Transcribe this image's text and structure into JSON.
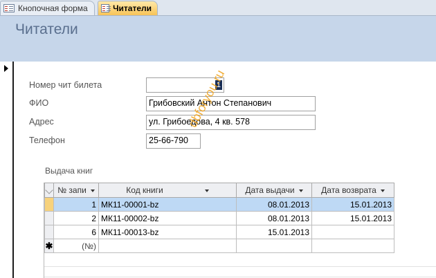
{
  "tabs": [
    {
      "label": "Кнопочная форма",
      "icon": "form-icon"
    },
    {
      "label": "Читатели",
      "icon": "form-icon"
    }
  ],
  "form": {
    "title": "Читатели",
    "fields": {
      "ticket": {
        "label": "Номер чит билета",
        "value": "1"
      },
      "fio": {
        "label": "ФИО",
        "value": "Грибовский Антон Степанович"
      },
      "address": {
        "label": "Адрес",
        "value": "ул. Грибоедова, 4 кв. 578"
      },
      "phone": {
        "label": "Телефон",
        "value": "25-66-790"
      }
    },
    "watermark": "dbforyou.ru"
  },
  "subform": {
    "label": "Выдача книг",
    "columns": [
      "№ запи",
      "Код книги",
      "Дата выдачи",
      "Дата возврата"
    ],
    "rows": [
      {
        "num": "1",
        "code": "МК11-00001-bz",
        "issued": "08.01.2013",
        "returned": "15.01.2013"
      },
      {
        "num": "2",
        "code": "МК11-00002-bz",
        "issued": "08.01.2013",
        "returned": "15.01.2013"
      },
      {
        "num": "6",
        "code": "МК11-00013-bz",
        "issued": "15.01.2013",
        "returned": ""
      }
    ],
    "new_row": {
      "marker": "✱",
      "num_placeholder": "(№)"
    }
  }
}
